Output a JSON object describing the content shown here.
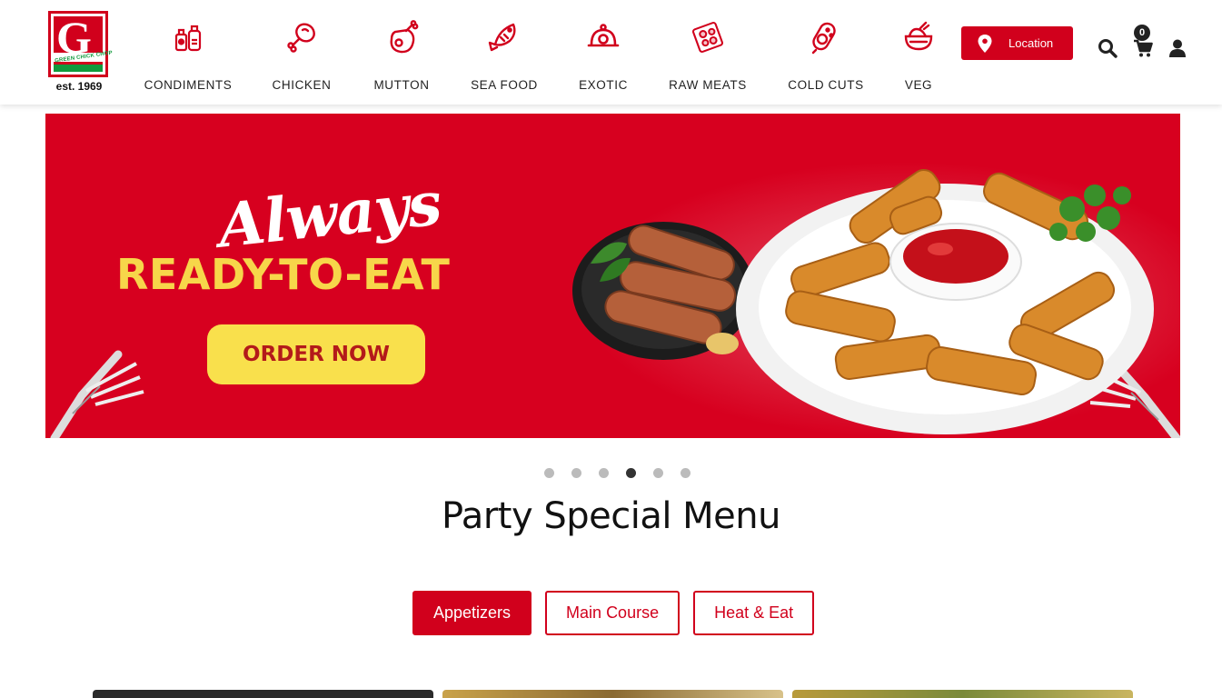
{
  "brand": {
    "logo_text": "G",
    "logo_tagline": "GREEN CHICK CHOP",
    "est": "est. 1969",
    "primary_color": "#d1001c",
    "accent_green": "#109a3c"
  },
  "nav": {
    "items": [
      {
        "label": "CONDIMENTS",
        "icon": "condiments-icon"
      },
      {
        "label": "CHICKEN",
        "icon": "chicken-leg-icon"
      },
      {
        "label": "MUTTON",
        "icon": "mutton-icon"
      },
      {
        "label": "SEA FOOD",
        "icon": "fish-icon"
      },
      {
        "label": "EXOTIC",
        "icon": "cloche-icon"
      },
      {
        "label": "RAW MEATS",
        "icon": "raw-meat-tray-icon"
      },
      {
        "label": "COLD CUTS",
        "icon": "salami-icon"
      },
      {
        "label": "VEG",
        "icon": "veg-bowl-icon"
      }
    ]
  },
  "header": {
    "location_label": "Location",
    "cart_count": "0"
  },
  "banner": {
    "script_text": "Always",
    "headline": "READY-TO-EAT",
    "cta": "ORDER NOW",
    "background_color": "#d7001f",
    "cta_color": "#f9e04c"
  },
  "carousel": {
    "total_slides": 6,
    "active_index": 3
  },
  "menu": {
    "title": "Party Special Menu",
    "tabs": [
      {
        "label": "Appetizers",
        "active": true
      },
      {
        "label": "Main Course",
        "active": false
      },
      {
        "label": "Heat & Eat",
        "active": false
      }
    ]
  }
}
